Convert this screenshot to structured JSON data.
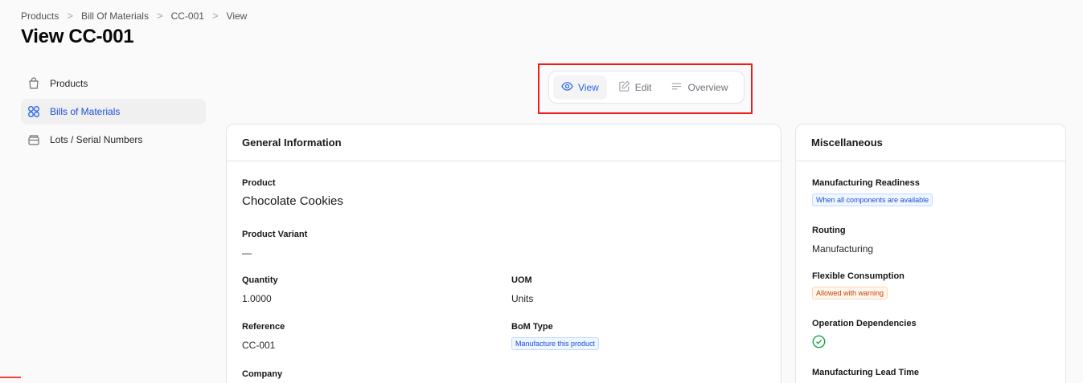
{
  "breadcrumb": {
    "items": [
      "Products",
      "Bill Of Materials",
      "CC-001",
      "View"
    ],
    "separator": ">"
  },
  "page_title": "View CC-001",
  "sidebar": {
    "items": [
      {
        "label": "Products",
        "icon": "shopping-bag-icon",
        "active": false
      },
      {
        "label": "Bills of Materials",
        "icon": "grid-icon",
        "active": true
      },
      {
        "label": "Lots / Serial Numbers",
        "icon": "archive-icon",
        "active": false
      }
    ]
  },
  "tabs": {
    "items": [
      {
        "label": "View",
        "icon": "eye-icon",
        "active": true
      },
      {
        "label": "Edit",
        "icon": "pencil-icon",
        "active": false
      },
      {
        "label": "Overview",
        "icon": "lines-icon",
        "active": false
      }
    ]
  },
  "general": {
    "title": "General Information",
    "product_label": "Product",
    "product_value": "Chocolate Cookies",
    "variant_label": "Product Variant",
    "variant_value": "—",
    "quantity_label": "Quantity",
    "quantity_value": "1.0000",
    "uom_label": "UOM",
    "uom_value": "Units",
    "reference_label": "Reference",
    "reference_value": "CC-001",
    "bom_type_label": "BoM Type",
    "bom_type_value": "Manufacture this product",
    "company_label": "Company"
  },
  "misc": {
    "title": "Miscellaneous",
    "readiness_label": "Manufacturing Readiness",
    "readiness_value": "When all components are available",
    "routing_label": "Routing",
    "routing_value": "Manufacturing",
    "consumption_label": "Flexible Consumption",
    "consumption_value": "Allowed with warning",
    "dependencies_label": "Operation Dependencies",
    "dependencies_icon": "check-circle-icon",
    "lead_time_label": "Manufacturing Lead Time"
  },
  "colors": {
    "accent": "#2563eb",
    "highlight": "#ef1c1c",
    "success": "#16a34a",
    "warning": "#c2410c"
  }
}
